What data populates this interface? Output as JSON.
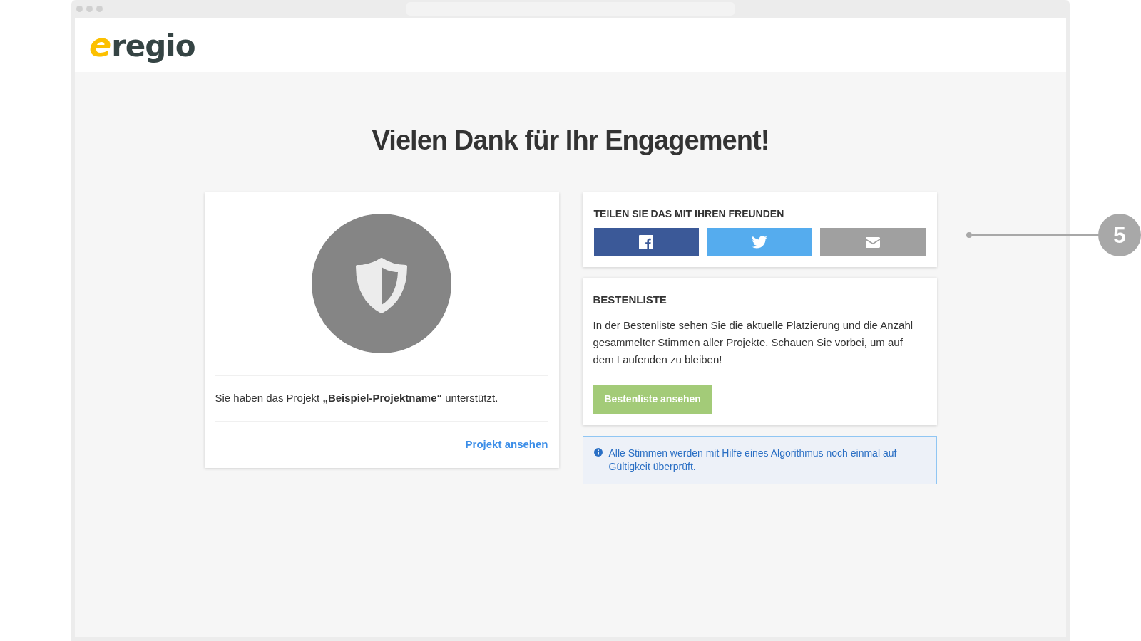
{
  "logo": {
    "mark": "e",
    "text": "regio"
  },
  "heading": "Vielen Dank für Ihr Engagement!",
  "project_card": {
    "message": "Sie haben das Projekt **„Beispiel-Projektname“** unterstützt.",
    "link": "Projekt ansehen"
  },
  "share_card": {
    "title": "TEILEN SIE DAS MIT IHREN FREUNDEN",
    "buttons": [
      {
        "kind": "facebook",
        "color": "#3b5998"
      },
      {
        "kind": "twitter",
        "color": "#55acee"
      },
      {
        "kind": "email",
        "color": "#a0a0a0"
      }
    ]
  },
  "leaderboard_card": {
    "title": "BESTENLISTE",
    "text": "In der Bestenliste sehen Sie die aktuelle Platzierung und die Anzahl gesammelter Stimmen aller Projekte. Schauen Sie vorbei, um auf dem Laufenden zu bleiben!",
    "button": "Bestenliste ansehen"
  },
  "info": "Alle Stimmen werden mit Hilfe eines Algorithmus noch einmal auf Gültigkeit überprüft.",
  "callout": "5"
}
